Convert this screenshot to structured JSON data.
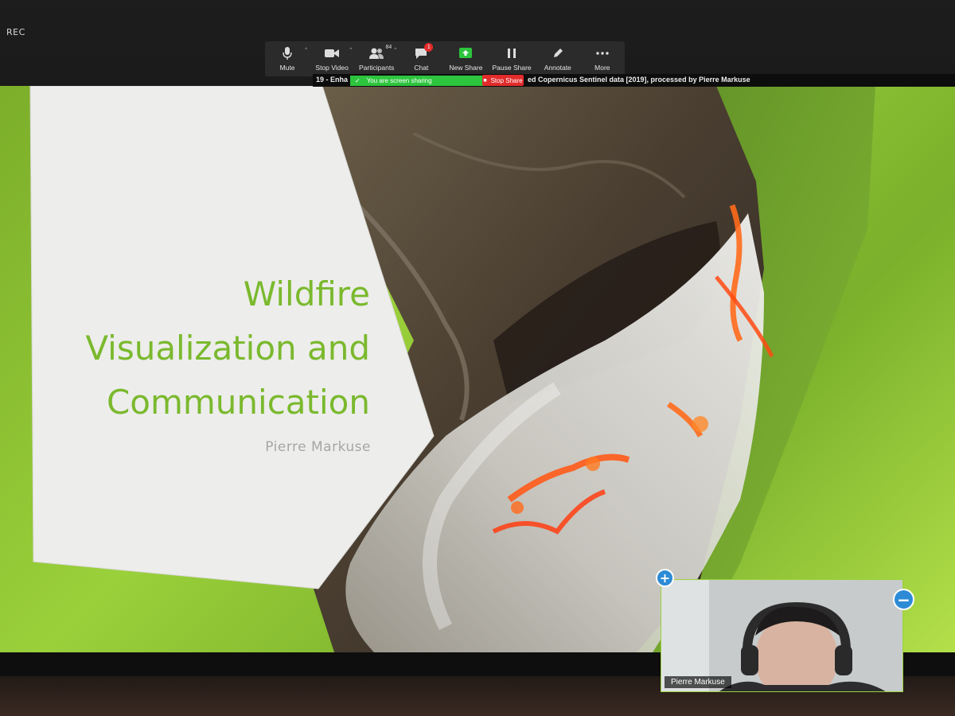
{
  "recording": {
    "label": "REC"
  },
  "toolbar": {
    "mute_label": "Mute",
    "stop_video_label": "Stop Video",
    "participants_label": "Participants",
    "participants_count": "84",
    "chat_label": "Chat",
    "chat_badge": "1",
    "new_share_label": "New Share",
    "pause_share_label": "Pause Share",
    "annotate_label": "Annotate",
    "more_label": "More"
  },
  "share_bar": {
    "title_start": "19 - Enha",
    "title_end": "ed Copernicus Sentinel data [2019], processed by Pierre Markuse",
    "sharing_status": "You are screen sharing",
    "stop_share_label": "Stop Share"
  },
  "slide": {
    "title_line1": "Wildfire",
    "title_line2": "Visualization and",
    "title_line3": "Communication",
    "author": "Pierre Markuse"
  },
  "video_tile": {
    "participant_name": "Pierre Markuse",
    "add_symbol": "+",
    "minimize_symbol": "−"
  },
  "colors": {
    "title_green": "#7ab92d",
    "zoom_green": "#2dc43e",
    "stop_red": "#e22b2b",
    "zoom_blue": "#2d8bd6"
  }
}
